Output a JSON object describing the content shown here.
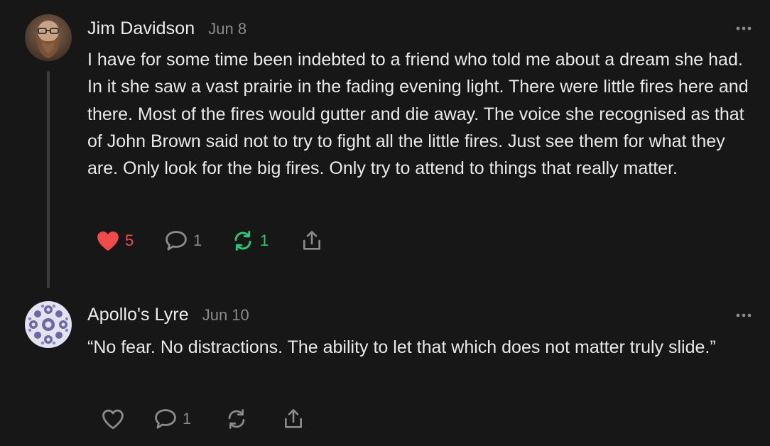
{
  "colors": {
    "background": "#171717",
    "text": "#e9e9ea",
    "muted": "#8b8b8e",
    "like_active": "#ef4b4b",
    "restack_active": "#2fc27a",
    "thread_line": "#3c3c3e"
  },
  "posts": [
    {
      "author": "Jim Davidson",
      "date": "Jun 8",
      "avatar_icon": "bearded-man-avatar",
      "text": "I have for some time been indebted to a friend who told me about a dream she had. In it she saw a vast prairie in the fading evening light. There were little fires here and there. Most of the fires would gutter and die away. The voice she recognised as that of John Brown said not to try to fight all the little fires. Just see them for what they are. Only look for the big fires. Only try to attend to things that really matter.",
      "likes": "5",
      "liked": true,
      "comments": "1",
      "restacks": "1",
      "restacked": true
    },
    {
      "author": "Apollo's Lyre",
      "date": "Jun 10",
      "avatar_icon": "fractal-pattern-avatar",
      "text": "“No fear. No distractions. The ability to let that which does not matter truly slide.”",
      "likes": "",
      "liked": false,
      "comments": "1",
      "restacks": "",
      "restacked": false
    }
  ]
}
